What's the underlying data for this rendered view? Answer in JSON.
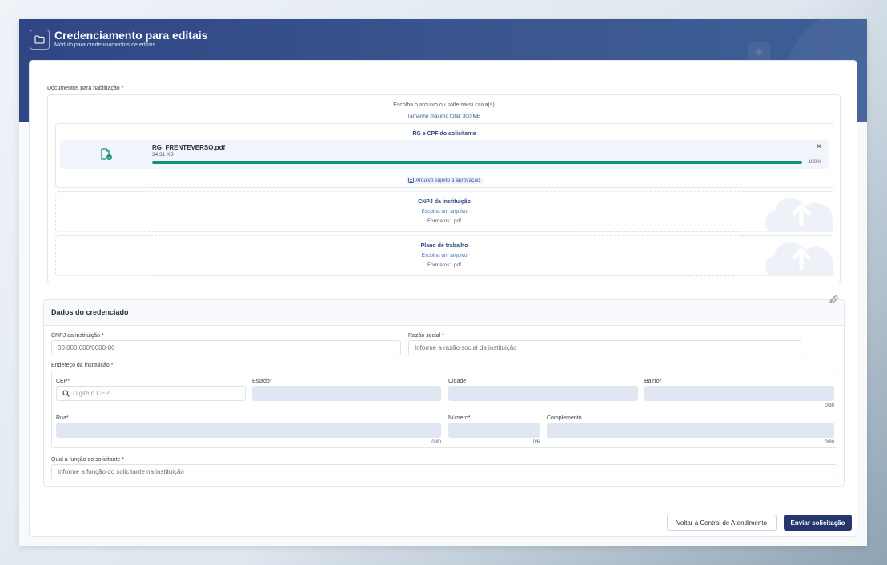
{
  "header": {
    "title": "Credenciamento para editais",
    "subtitle": "Módulo para credenciamentos de editais"
  },
  "documents": {
    "label": "Documentos para habilitação *",
    "choose_text": "Escolha o arquivo ou solte na(s) caixa(s)",
    "max_size": "Tamanho máximo total: 300 MB",
    "slots": [
      {
        "title": "RG e CPF do solicitante",
        "file": {
          "name": "RG_FRENTEVERSO.pdf",
          "size": "34.31 KB",
          "progress_label": "100%",
          "progress_fraction": 1.0,
          "close_glyph": "×"
        },
        "approval": "Arquivo sujeito a aprovação"
      },
      {
        "title": "CNPJ da instituição",
        "link": "Escolha um arquivo",
        "formats": "Formatos: .pdf"
      },
      {
        "title": "Plano de trabalho",
        "link": "Escolha um arquivo",
        "formats": "Formatos: .pdf"
      }
    ]
  },
  "credenciado": {
    "title": "Dados do credenciado",
    "cnpj_label": "CNPJ da instituição *",
    "cnpj_placeholder": "00.000.000/0000-00",
    "razao_label": "Razão social *",
    "razao_placeholder": "Informe a razão social da instituição",
    "endereco_label": "Endereço da instituição *",
    "cep_label": "CEP*",
    "cep_placeholder": "Digite o CEP",
    "estado_label": "Estado*",
    "cidade_label": "Cidade",
    "bairro_label": "Bairro*",
    "bairro_counter": "0/30",
    "rua_label": "Rua*",
    "rua_counter": "0/80",
    "numero_label": "Número*",
    "numero_counter": "0/6",
    "complemento_label": "Complemento",
    "complemento_counter": "0/80",
    "funcao_label": "Qual a função do solicitante *",
    "funcao_placeholder": "Informe a função do solicitante na instituição"
  },
  "actions": {
    "back_label": "Voltar à Central de Atendimento",
    "submit_label": "Enviar solicitação"
  },
  "colors": {
    "header": "#2f4684",
    "accent": "#109177",
    "primary_button": "#24366b",
    "link": "#3f74c9"
  }
}
